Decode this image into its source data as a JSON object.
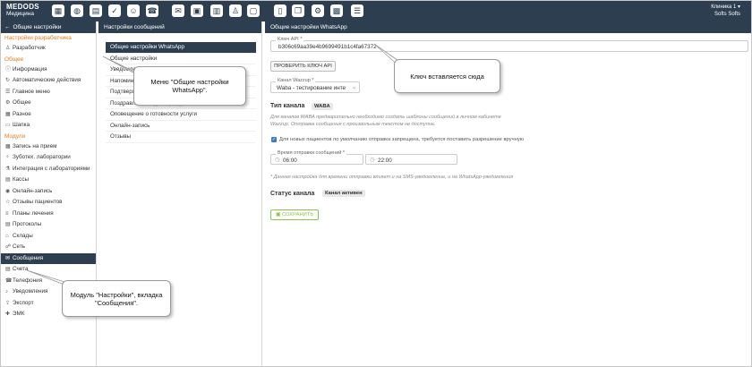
{
  "topbar": {
    "brand_line1": "MEDODS",
    "brand_line2": "Медицина",
    "icons": [
      "calendar-icon",
      "handshake-icon",
      "document-icon",
      "check-icon",
      "group-icon",
      "phone-icon",
      "mail-icon",
      "user-card-icon",
      "chart-icon",
      "person-icon",
      "id-card-icon",
      "books-icon",
      "copy-icon",
      "gear-icon",
      "building-icon",
      "list-icon"
    ],
    "clinic": "Клиника 1",
    "user": "Softs Softs"
  },
  "sidebar": {
    "title": "Общие настройки",
    "sections": [
      {
        "label": "Настройки разработчика",
        "items": [
          {
            "label": "Разработчик",
            "icon": "person-icon"
          }
        ]
      },
      {
        "label": "Общее",
        "items": [
          {
            "label": "Информация",
            "icon": "info-icon"
          },
          {
            "label": "Автоматические действия",
            "icon": "refresh-icon"
          },
          {
            "label": "Главное меню",
            "icon": "menu-icon"
          },
          {
            "label": "Общее",
            "icon": "gear-icon"
          },
          {
            "label": "Разное",
            "icon": "grid-icon"
          },
          {
            "label": "Шапка",
            "icon": "header-icon"
          }
        ]
      },
      {
        "label": "Модули",
        "items": [
          {
            "label": "Запись на прием",
            "icon": "calendar-icon"
          },
          {
            "label": "Зуботех. лаборатории",
            "icon": "tooth-icon"
          },
          {
            "label": "Интеграция с лабораториями",
            "icon": "flask-icon"
          },
          {
            "label": "Кассы",
            "icon": "cash-icon"
          },
          {
            "label": "Онлайн-запись",
            "icon": "globe-icon"
          },
          {
            "label": "Отзывы пациентов",
            "icon": "star-icon"
          },
          {
            "label": "Планы лечения",
            "icon": "list-icon"
          },
          {
            "label": "Протоколы",
            "icon": "doc-icon"
          },
          {
            "label": "Склады",
            "icon": "warehouse-icon"
          },
          {
            "label": "Сеть",
            "icon": "network-icon"
          },
          {
            "label": "Сообщения",
            "icon": "chat-icon",
            "active": true
          },
          {
            "label": "Счета",
            "icon": "invoice-icon"
          },
          {
            "label": "Телефония",
            "icon": "phone-icon"
          },
          {
            "label": "Уведомления",
            "icon": "bell-icon"
          },
          {
            "label": "Экспорт",
            "icon": "export-icon"
          },
          {
            "label": "ЭМК",
            "icon": "medical-icon"
          }
        ]
      }
    ]
  },
  "middle": {
    "title": "Настройки сообщений",
    "items": [
      "Общие настройки WhatsApp",
      "Общие настройки",
      "Уведомлени",
      "Напоминан",
      "Подтвержд",
      "Поздравление с днём рождения",
      "Оповещение о готовности услуги",
      "Онлайн-запись",
      "Отзывы"
    ]
  },
  "right": {
    "title": "Общие настройки WhatsApp",
    "api_key_label": "Ключ API *",
    "api_key_value": "b306c69aa39e4b9699491b1c4fa67372",
    "check_key_button": "ПРОВЕРИТЬ КЛЮЧ API",
    "wazzup_label": "Канал Wazzup *",
    "wazzup_value": "Waba - тестирование инте",
    "channel_type_label": "Тип канала",
    "channel_type_value": "WABA",
    "waba_hint": "Для каналов WABA предварительно необходимо создать шаблоны сообщений в личном кабинете Wazzup. Отправка сообщения с произвольным текстом не доступна.",
    "new_patients_label": "Для новых пациентов по умолчанию отправка запрещена, требуется поставить разрешение вручную",
    "send_time_label": "Время отправки сообщений *",
    "time_from": "06:00",
    "time_to": "22:00",
    "time_hint": "* Данная настройка для времени отправки влияет и на SMS-уведомление, и на WhatsApp-уведомления",
    "channel_status_label": "Статус канала",
    "channel_status_value": "Канал активен",
    "save_button": "СОХРАНИТЬ"
  },
  "callouts": {
    "whatsapp_menu": "Меню \"Общие настройки WhatsApp\".",
    "key_here": "Ключ вставляется сюда",
    "module_tab": "Модуль \"Настройки\", вкладка \"Сообщения\"."
  }
}
